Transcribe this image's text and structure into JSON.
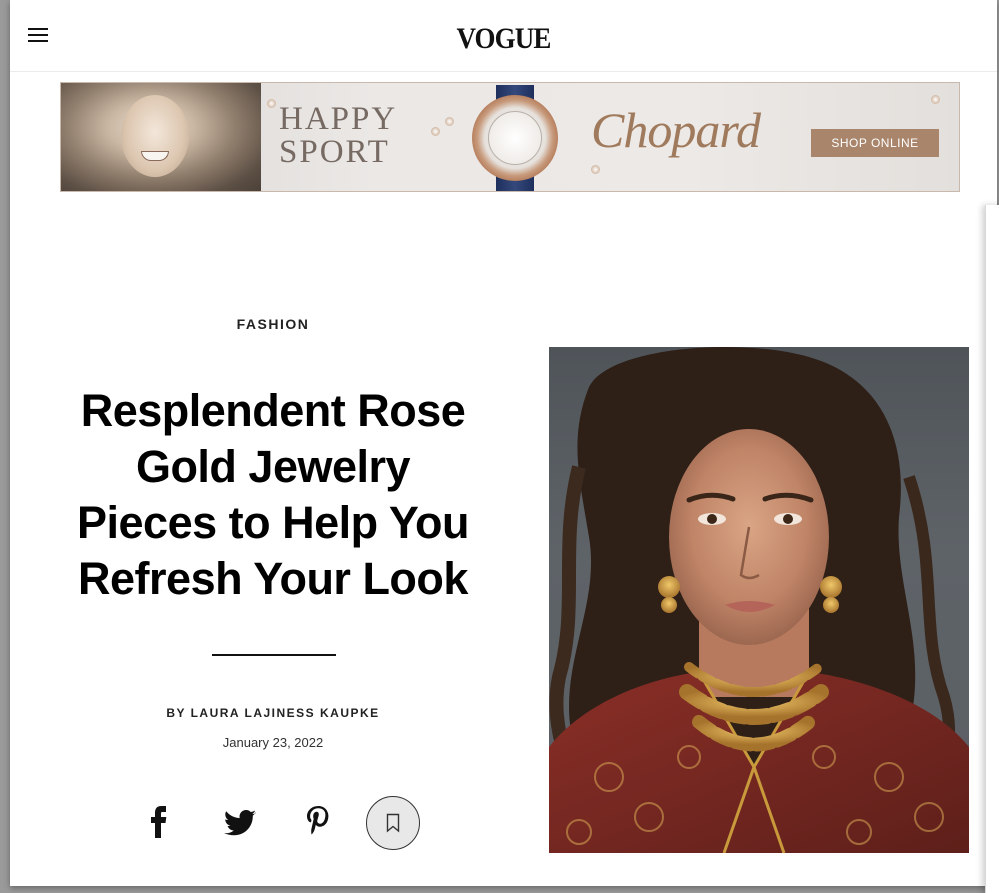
{
  "header": {
    "logo": "VOGUE",
    "menu_icon": "hamburger-menu-icon"
  },
  "ad": {
    "headline_line1": "HAPPY",
    "headline_line2": "SPORT",
    "brand": "Chopard",
    "cta": "SHOP ONLINE"
  },
  "article": {
    "kicker": "FASHION",
    "headline_lines": [
      "Resplendent Rose",
      "Gold Jewelry",
      "Pieces to Help You",
      "Refresh Your Look"
    ],
    "byline": "BY LAURA LAJINESS KAUPKE",
    "date": "January 23, 2022"
  },
  "share": {
    "icons": [
      "facebook-icon",
      "twitter-icon",
      "pinterest-icon",
      "bookmark-icon"
    ]
  },
  "colors": {
    "ad_cta_bg": "#a9856b",
    "ad_brand": "#a07a5c",
    "hero_bg": "#5a5f64",
    "jacket": "#7a2a22",
    "gold": "#c89a3c"
  }
}
